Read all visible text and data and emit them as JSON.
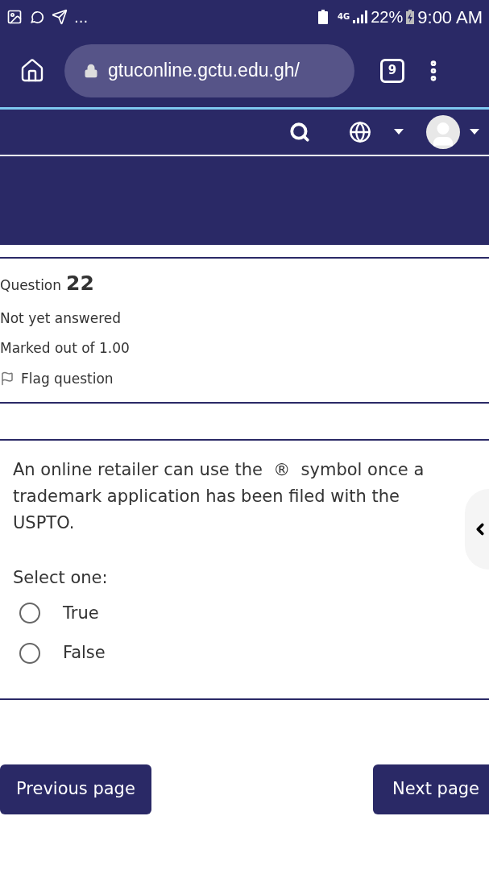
{
  "status_bar": {
    "overflow": "...",
    "network": "4G",
    "battery": "22%",
    "time": "9:00 AM"
  },
  "browser": {
    "url": "gtuconline.gctu.edu.gh/",
    "tab_count": "9"
  },
  "question_info": {
    "label": "Question",
    "number": "22",
    "state": "Not yet answered",
    "marks": "Marked out of 1.00",
    "flag": "Flag question"
  },
  "question": {
    "text": "An online retailer can use the  ®  symbol once a trademark application has been filed with the USPTO.",
    "prompt": "Select one:",
    "options": [
      {
        "label": "True",
        "selected": false
      },
      {
        "label": "False",
        "selected": false
      }
    ]
  },
  "nav_buttons": [
    "Previous page",
    "Next page"
  ]
}
